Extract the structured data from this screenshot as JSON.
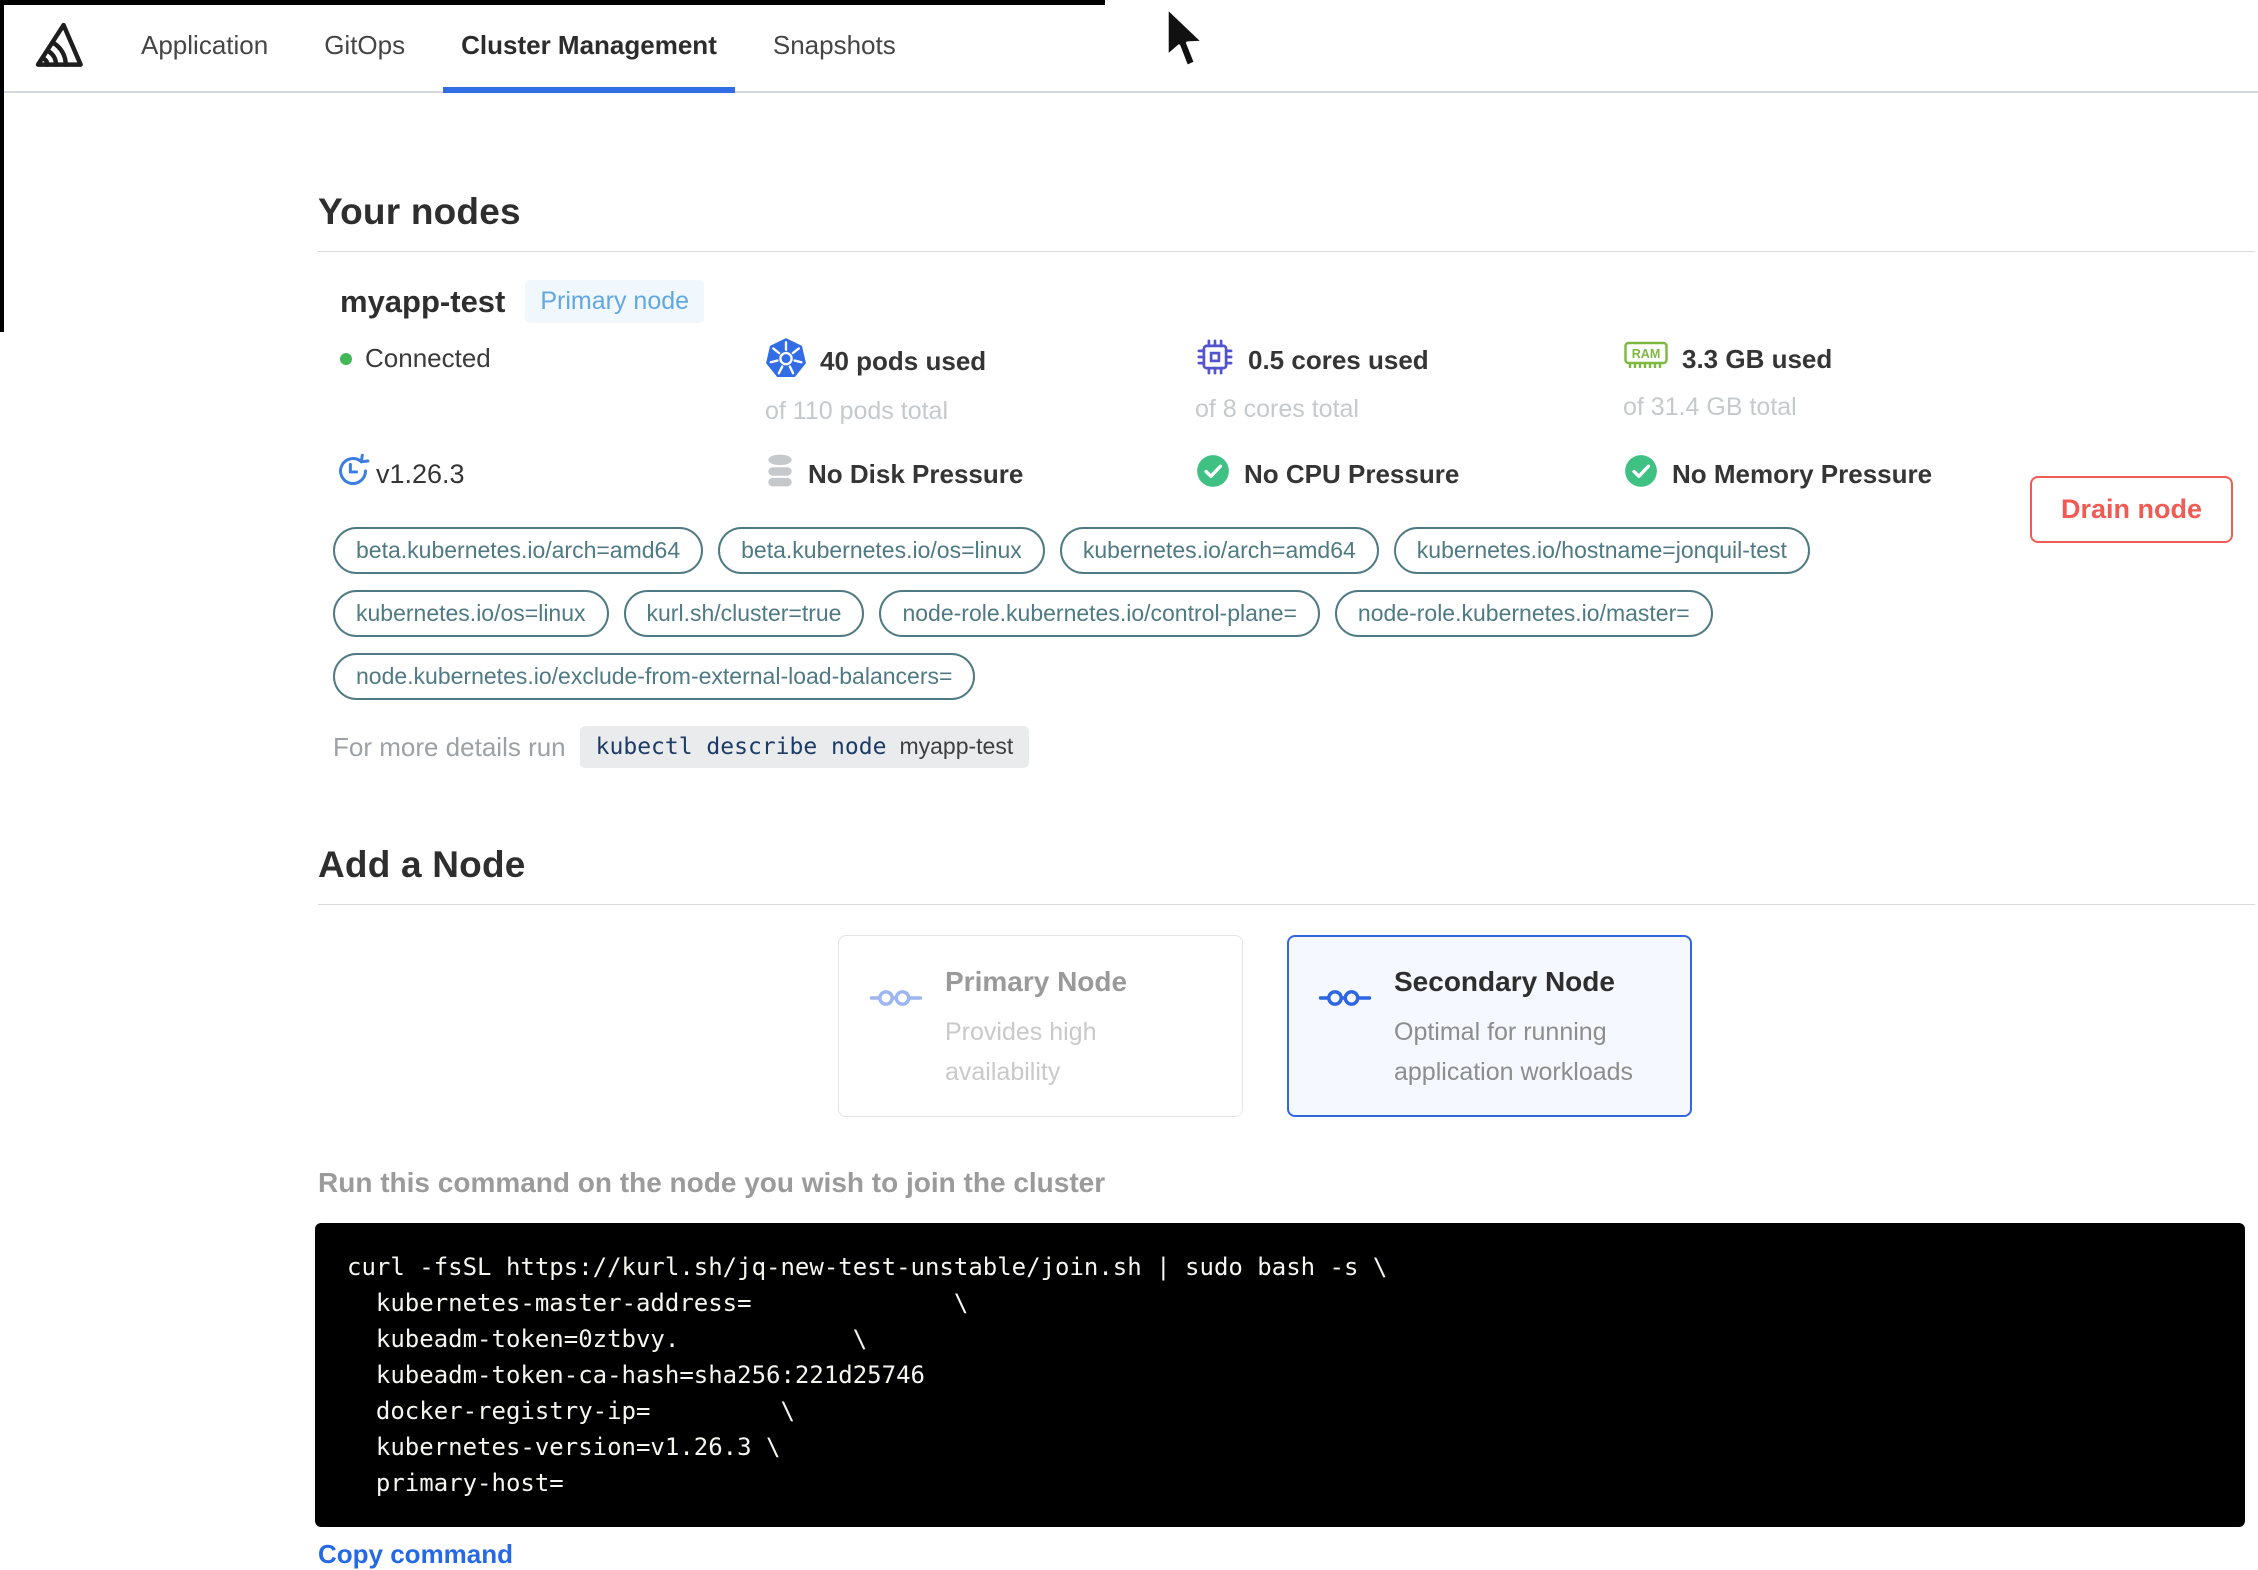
{
  "header": {
    "logo": "replicated-logo",
    "tabs": [
      {
        "label": "Application",
        "active": false
      },
      {
        "label": "GitOps",
        "active": false
      },
      {
        "label": "Cluster Management",
        "active": true
      },
      {
        "label": "Snapshots",
        "active": false
      }
    ]
  },
  "your_nodes": {
    "heading": "Your nodes",
    "node": {
      "name": "myapp-test",
      "badge": "Primary node",
      "status": "Connected",
      "version": "v1.26.3",
      "stats": [
        {
          "icon": "kubernetes-icon",
          "used": "40 pods used",
          "total": "of 110 pods total"
        },
        {
          "icon": "cpu-icon",
          "used": "0.5 cores used",
          "total": "of 8 cores total"
        },
        {
          "icon": "ram-icon",
          "used": "3.3 GB used",
          "total": "of 31.4 GB total"
        }
      ],
      "conditions": [
        {
          "icon": "disk-icon",
          "label": "No Disk Pressure"
        },
        {
          "icon": "check-circle-icon",
          "label": "No CPU Pressure"
        },
        {
          "icon": "check-circle-icon",
          "label": "No Memory Pressure"
        }
      ],
      "labels": [
        "beta.kubernetes.io/arch=amd64",
        "beta.kubernetes.io/os=linux",
        "kubernetes.io/arch=amd64",
        "kubernetes.io/hostname=jonquil-test",
        "kubernetes.io/os=linux",
        "kurl.sh/cluster=true",
        "node-role.kubernetes.io/control-plane=",
        "node-role.kubernetes.io/master=",
        "node.kubernetes.io/exclude-from-external-load-balancers="
      ],
      "details": {
        "prefix": "For more details run",
        "command": "kubectl describe node",
        "node_name": "myapp-test"
      },
      "drain_button": "Drain node"
    }
  },
  "add_node": {
    "heading": "Add a Node",
    "options": [
      {
        "title": "Primary Node",
        "description": "Provides high availability",
        "selected": false
      },
      {
        "title": "Secondary Node",
        "description": "Optimal for running application workloads",
        "selected": true
      }
    ],
    "instruction": "Run this command on the node you wish to join the cluster",
    "join_command_lines": [
      "curl -fsSL https://kurl.sh/jq-new-test-unstable/join.sh | sudo bash -s \\",
      "  kubernetes-master-address=              \\",
      "  kubeadm-token=0ztbvy.            \\",
      "  kubeadm-token-ca-hash=sha256:221d25746",
      "  docker-registry-ip=         \\",
      "  kubernetes-version=v1.26.3 \\",
      "  primary-host="
    ],
    "copy_link": "Copy command"
  },
  "colors": {
    "accent_blue": "#326de6",
    "drain_red": "#f25a54",
    "label_teal": "#4f7a83",
    "connected_green": "#41b958",
    "check_green": "#3fc183",
    "ram_green": "#7cb93e",
    "cpu_indigo": "#5353cf",
    "badge_blue": "#63a7e1",
    "code_bg": "#000000"
  }
}
